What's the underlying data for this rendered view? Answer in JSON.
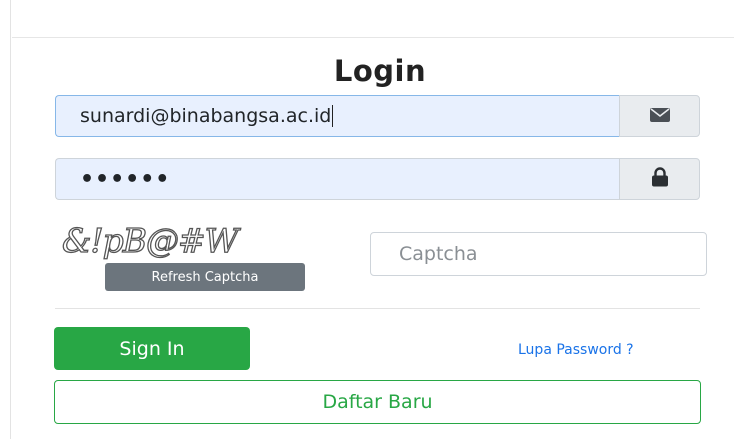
{
  "form": {
    "title": "Login",
    "email": {
      "value": "sunardi@binabangsa.ac.id",
      "icon": "envelope-icon"
    },
    "password": {
      "value": "••••••",
      "icon": "lock-icon"
    },
    "captcha": {
      "image_text": "&!pB@#W",
      "refresh_label": "Refresh Captcha",
      "placeholder": "Captcha"
    },
    "signin_label": "Sign In",
    "forgot_label": "Lupa Password ?",
    "register_label": "Daftar Baru"
  },
  "colors": {
    "primary_green": "#28a745",
    "link_blue": "#1a73e8",
    "autofill_bg": "#e8f0fe",
    "secondary_gray": "#6c757d"
  }
}
